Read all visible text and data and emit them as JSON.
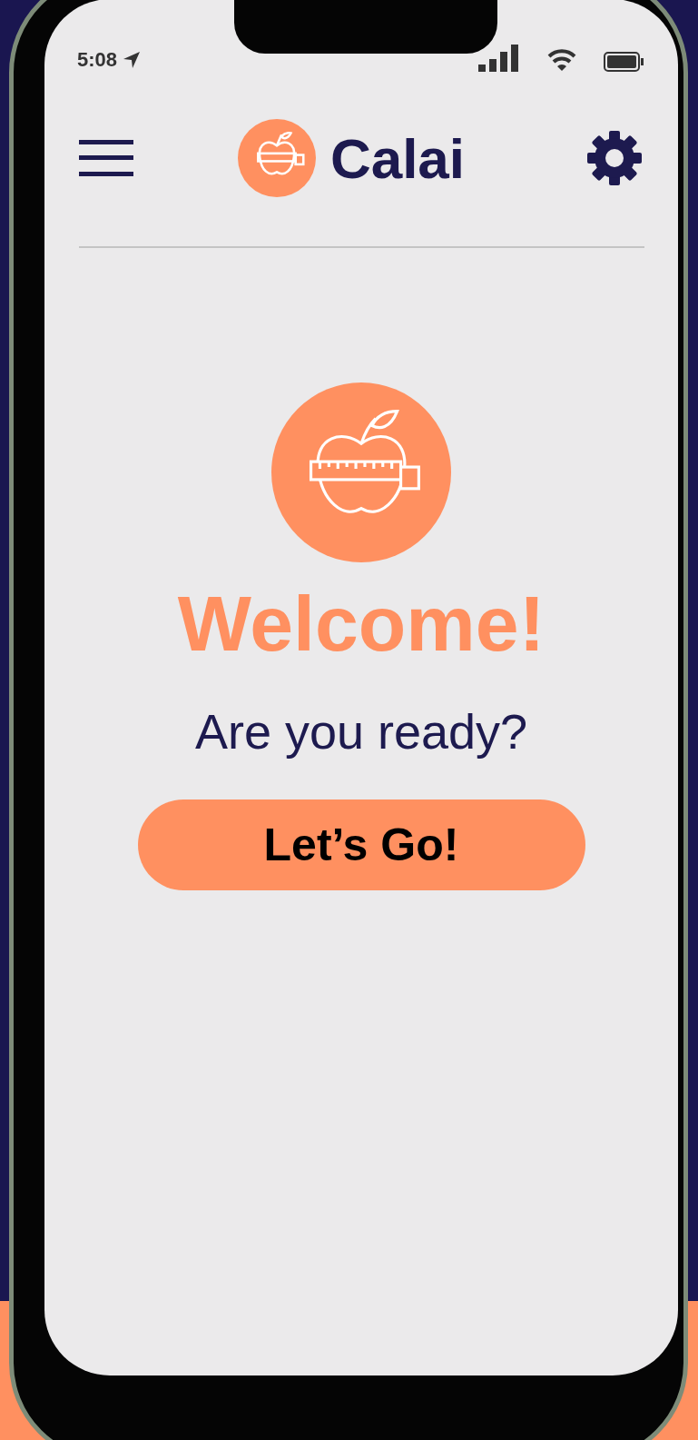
{
  "status_bar": {
    "time": "5:08"
  },
  "header": {
    "title": "Calai"
  },
  "welcome": {
    "title": "Welcome!",
    "subtitle": "Are you ready?"
  },
  "button": {
    "label": "Let’s Go!"
  }
}
